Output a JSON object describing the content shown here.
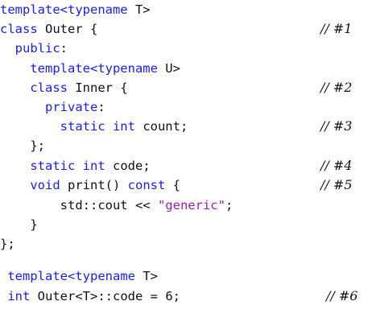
{
  "colors": {
    "keyword": "#1a1aff",
    "string": "#9a1fb0",
    "text": "#111111"
  },
  "lines": [
    {
      "segments": [
        {
          "t": "template<typename",
          "k": "kw"
        },
        {
          "t": " T>",
          "k": "txt"
        }
      ]
    },
    {
      "segments": [
        {
          "t": "class",
          "k": "kw"
        },
        {
          "t": " Outer {",
          "k": "txt"
        }
      ],
      "comment": "// #1"
    },
    {
      "segments": [
        {
          "t": "  ",
          "k": "txt"
        },
        {
          "t": "public",
          "k": "kw"
        },
        {
          "t": ":",
          "k": "txt"
        }
      ]
    },
    {
      "segments": [
        {
          "t": "    ",
          "k": "txt"
        },
        {
          "t": "template<typename",
          "k": "kw"
        },
        {
          "t": " U>",
          "k": "txt"
        }
      ]
    },
    {
      "segments": [
        {
          "t": "    ",
          "k": "txt"
        },
        {
          "t": "class",
          "k": "kw"
        },
        {
          "t": " Inner {",
          "k": "txt"
        }
      ],
      "comment": "// #2"
    },
    {
      "segments": [
        {
          "t": "      ",
          "k": "txt"
        },
        {
          "t": "private",
          "k": "kw"
        },
        {
          "t": ":",
          "k": "txt"
        }
      ]
    },
    {
      "segments": [
        {
          "t": "        ",
          "k": "txt"
        },
        {
          "t": "static int",
          "k": "kw"
        },
        {
          "t": " count;",
          "k": "txt"
        }
      ],
      "comment": "// #3"
    },
    {
      "segments": [
        {
          "t": "    };",
          "k": "txt"
        }
      ]
    },
    {
      "segments": [
        {
          "t": "    ",
          "k": "txt"
        },
        {
          "t": "static int",
          "k": "kw"
        },
        {
          "t": " code;",
          "k": "txt"
        }
      ],
      "comment": "// #4"
    },
    {
      "segments": [
        {
          "t": "    ",
          "k": "txt"
        },
        {
          "t": "void",
          "k": "kw"
        },
        {
          "t": " print() ",
          "k": "txt"
        },
        {
          "t": "const",
          "k": "kw"
        },
        {
          "t": " {",
          "k": "txt"
        }
      ],
      "comment": "// #5"
    },
    {
      "segments": [
        {
          "t": "        std::cout << ",
          "k": "txt"
        },
        {
          "t": "\"generic\"",
          "k": "str"
        },
        {
          "t": ";",
          "k": "txt"
        }
      ]
    },
    {
      "segments": [
        {
          "t": "    }",
          "k": "txt"
        }
      ]
    },
    {
      "segments": [
        {
          "t": "};",
          "k": "txt"
        }
      ]
    },
    {
      "segments": [
        {
          "t": " ",
          "k": "txt"
        },
        {
          "t": "template<typename",
          "k": "kw"
        },
        {
          "t": " T>",
          "k": "txt"
        }
      ]
    },
    {
      "segments": [
        {
          "t": " ",
          "k": "txt"
        },
        {
          "t": "int",
          "k": "kw"
        },
        {
          "t": " Outer<T>::code = 6;",
          "k": "txt"
        }
      ],
      "comment": "// #6"
    }
  ]
}
